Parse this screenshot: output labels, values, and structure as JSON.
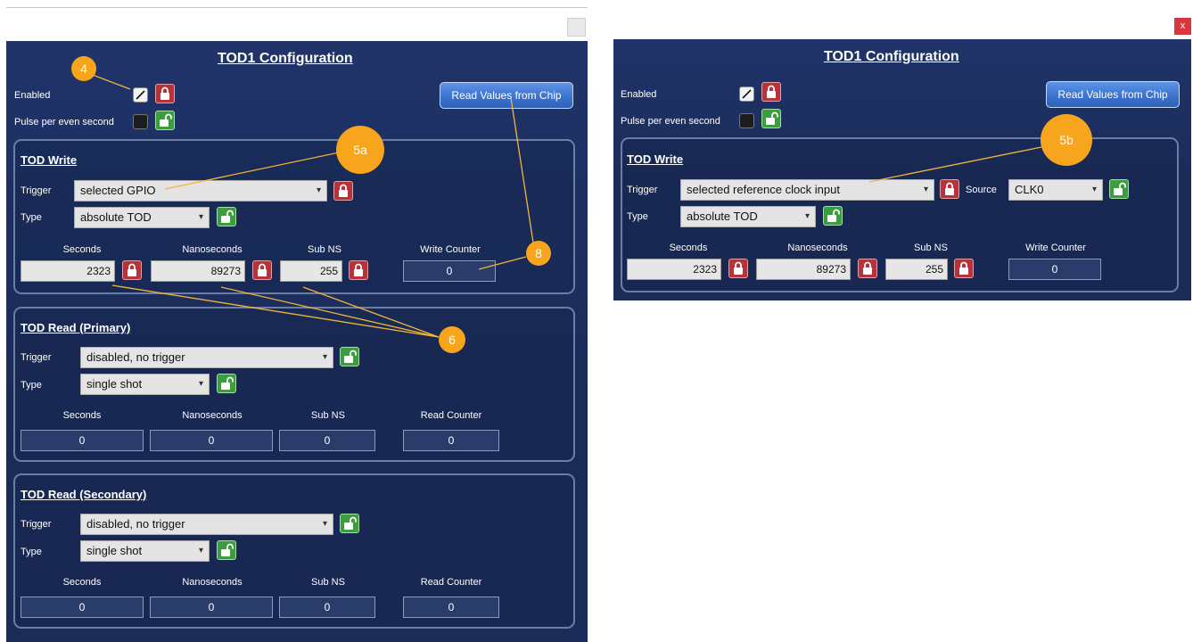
{
  "left": {
    "title": "TOD1 Configuration",
    "enabled_label": "Enabled",
    "pulse_label": "Pulse per even second",
    "read_button": "Read Values from Chip",
    "write": {
      "title": "TOD Write",
      "trigger_label": "Trigger",
      "trigger_value": "selected GPIO",
      "type_label": "Type",
      "type_value": "absolute TOD",
      "col_seconds": "Seconds",
      "col_nanoseconds": "Nanoseconds",
      "col_subns": "Sub NS",
      "col_counter": "Write Counter",
      "seconds": "2323",
      "nanoseconds": "89273",
      "subns": "255",
      "counter": "0"
    },
    "read_primary": {
      "title": "TOD Read (Primary)",
      "trigger_label": "Trigger",
      "trigger_value": "disabled, no trigger",
      "type_label": "Type",
      "type_value": "single shot",
      "col_seconds": "Seconds",
      "col_nanoseconds": "Nanoseconds",
      "col_subns": "Sub NS",
      "col_counter": "Read Counter",
      "seconds": "0",
      "nanoseconds": "0",
      "subns": "0",
      "counter": "0"
    },
    "read_secondary": {
      "title": "TOD Read (Secondary)",
      "trigger_label": "Trigger",
      "trigger_value": "disabled, no trigger",
      "type_label": "Type",
      "type_value": "single shot",
      "col_seconds": "Seconds",
      "col_nanoseconds": "Nanoseconds",
      "col_subns": "Sub NS",
      "col_counter": "Read Counter",
      "seconds": "0",
      "nanoseconds": "0",
      "subns": "0",
      "counter": "0"
    }
  },
  "right": {
    "title": "TOD1 Configuration",
    "enabled_label": "Enabled",
    "pulse_label": "Pulse per even second",
    "read_button": "Read Values from Chip",
    "close_label": "x",
    "write": {
      "title": "TOD Write",
      "trigger_label": "Trigger",
      "trigger_value": "selected reference clock input",
      "source_label": "Source",
      "source_value": "CLK0",
      "type_label": "Type",
      "type_value": "absolute TOD",
      "col_seconds": "Seconds",
      "col_nanoseconds": "Nanoseconds",
      "col_subns": "Sub NS",
      "col_counter": "Write Counter",
      "seconds": "2323",
      "nanoseconds": "89273",
      "subns": "255",
      "counter": "0"
    }
  },
  "callouts": {
    "c4": "4",
    "c5a": "5a",
    "c5b": "5b",
    "c6": "6",
    "c8": "8"
  },
  "colors": {
    "window_bg": "#1d2f5c",
    "callout": "#f6a51c",
    "lock_red": "#b8323a",
    "lock_green": "#3a9e3e",
    "button_blue": "#3b73d0",
    "close_red": "#d9363e"
  },
  "icons": {
    "chevron": "▾",
    "lock_closed": "lock-closed-icon",
    "lock_open": "lock-open-icon",
    "checkmark": "checkmark-icon"
  }
}
